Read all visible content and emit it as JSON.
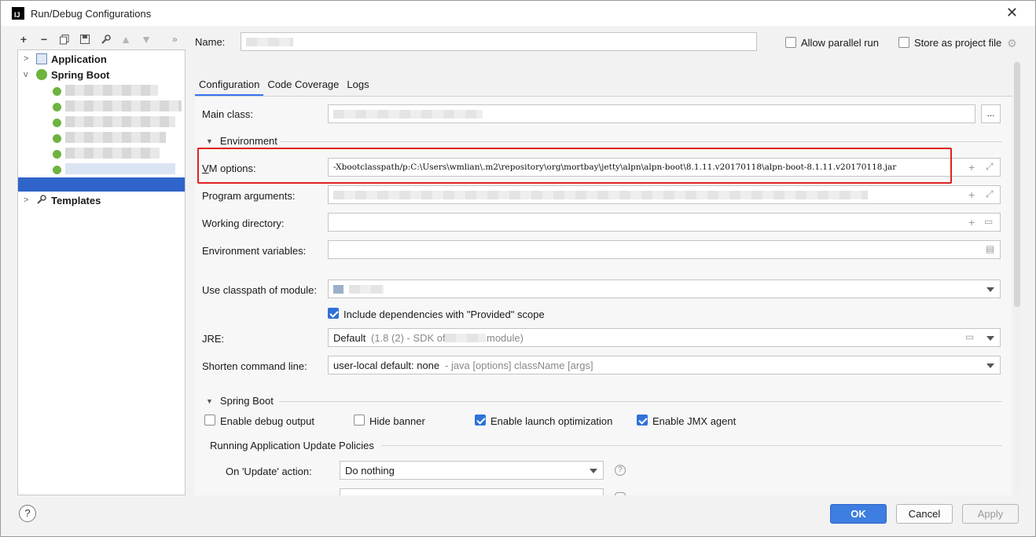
{
  "window": {
    "title": "Run/Debug Configurations"
  },
  "toolbar": {
    "icons": [
      "plus-icon",
      "minus-icon",
      "copy-icon",
      "save-icon",
      "wrench-icon",
      "arrow-up-icon",
      "arrow-down-icon",
      "more-icon"
    ]
  },
  "tree": {
    "application": "Application",
    "spring_boot": "Spring Boot",
    "templates": "Templates"
  },
  "header": {
    "name_label": "Name:",
    "name_value": "",
    "allow_parallel": "Allow parallel run",
    "store_project": "Store as project file"
  },
  "tabs": [
    "Configuration",
    "Code Coverage",
    "Logs"
  ],
  "form": {
    "main_class_label": "Main class:",
    "main_class_browse": "...",
    "environment_section": "Environment",
    "vm_options_label": "VM options:",
    "vm_options_value": "-Xbootclasspath/p:C:\\Users\\wmlian\\.m2\\repository\\org\\mortbay\\jetty\\alpn\\alpn-boot\\8.1.11.v20170118\\alpn-boot-8.1.11.v20170118.jar",
    "program_args_label": "Program arguments:",
    "working_dir_label": "Working directory:",
    "env_vars_label": "Environment variables:",
    "classpath_label": "Use classpath of module:",
    "include_deps": "Include dependencies with \"Provided\" scope",
    "jre_label": "JRE:",
    "jre_default": "Default",
    "jre_hint_a": "(1.8 (2) - SDK of",
    "jre_hint_b": "module)",
    "shorten_label": "Shorten command line:",
    "shorten_value": "user-local default: none",
    "shorten_hint": "- java [options] className [args]",
    "spring_boot_section": "Spring Boot",
    "enable_debug": "Enable debug output",
    "hide_banner": "Hide banner",
    "enable_launch_opt": "Enable launch optimization",
    "enable_jmx": "Enable JMX agent",
    "update_policies": "Running Application Update Policies",
    "on_update_label": "On 'Update' action:",
    "on_update_value": "Do nothing"
  },
  "checkboxes": {
    "allow_parallel": false,
    "store_project": false,
    "include_deps": true,
    "enable_debug": false,
    "hide_banner": false,
    "enable_launch_opt": true,
    "enable_jmx": true
  },
  "footer": {
    "help": "?",
    "ok": "OK",
    "cancel": "Cancel",
    "apply": "Apply"
  },
  "colors": {
    "accent": "#3574f0",
    "selection": "#2f65ca",
    "highlight_box": "#e02020",
    "spring_green": "#6db33f"
  }
}
